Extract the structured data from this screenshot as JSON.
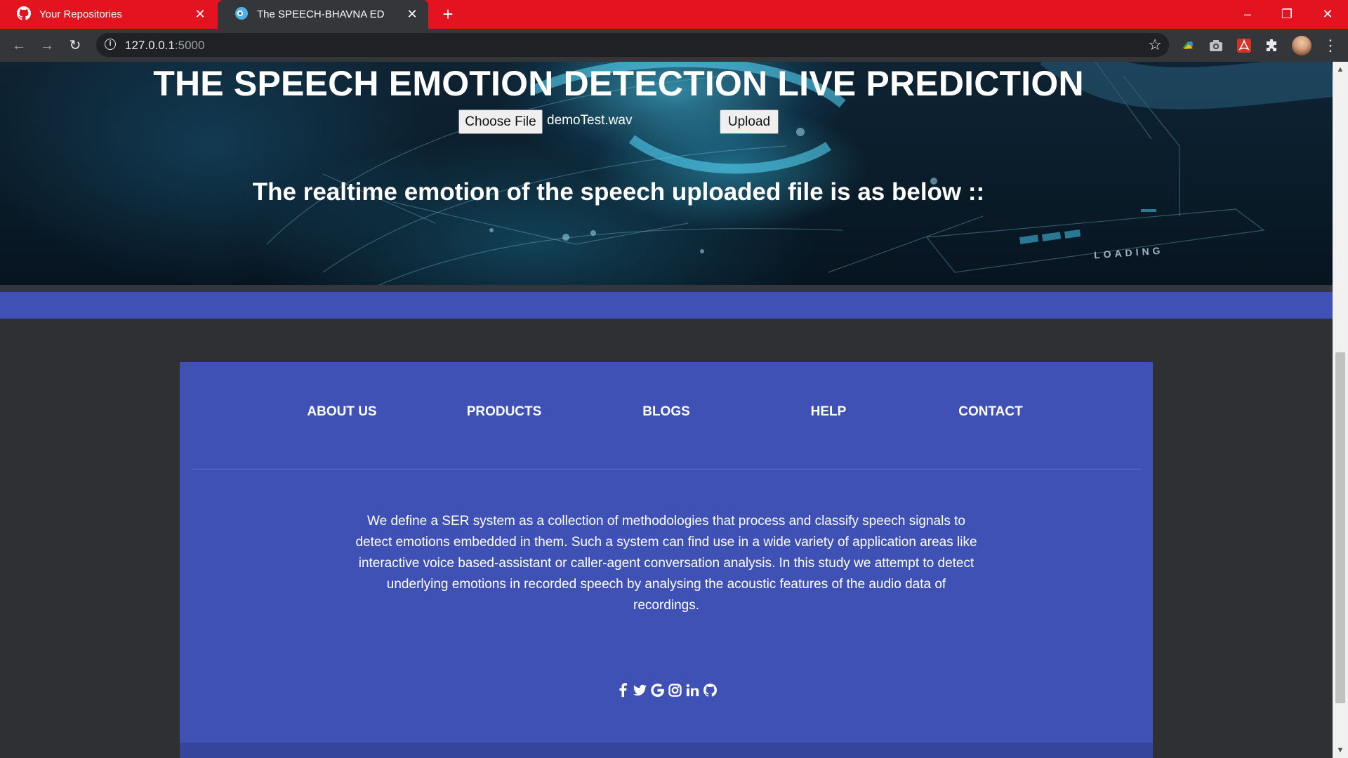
{
  "browser": {
    "tabs": [
      {
        "title": "Your Repositories",
        "icon": "github-icon"
      },
      {
        "title": "The SPEECH-BHAVNA ED",
        "icon": "site-favicon"
      }
    ],
    "url_host": "127.0.0.1",
    "url_port": ":5000"
  },
  "hero": {
    "title": "THE SPEECH EMOTION DETECTION LIVE PREDICTION",
    "choose_file_label": "Choose File",
    "selected_file": "demoTest.wav",
    "upload_label": "Upload",
    "result_heading": "The realtime emotion of the speech uploaded file is as below ::",
    "background_text": "LOADING"
  },
  "footer": {
    "nav": [
      "ABOUT US",
      "PRODUCTS",
      "BLOGS",
      "HELP",
      "CONTACT"
    ],
    "about_text": "We define a SER system as a collection of methodologies that process and classify speech signals to detect emotions embedded in them. Such a system can find use in a wide variety of application areas like interactive voice based-assistant or caller-agent conversation analysis. In this study we attempt to detect underlying emotions in recorded speech by analysing the acoustic features of the audio data of recordings.",
    "social_icons": [
      "facebook-icon",
      "twitter-icon",
      "google-icon",
      "instagram-icon",
      "linkedin-icon",
      "github-icon"
    ]
  },
  "colors": {
    "tab_bar": "#e3131f",
    "footer_blue": "#3f51b5",
    "page_dark": "#2f3033"
  }
}
